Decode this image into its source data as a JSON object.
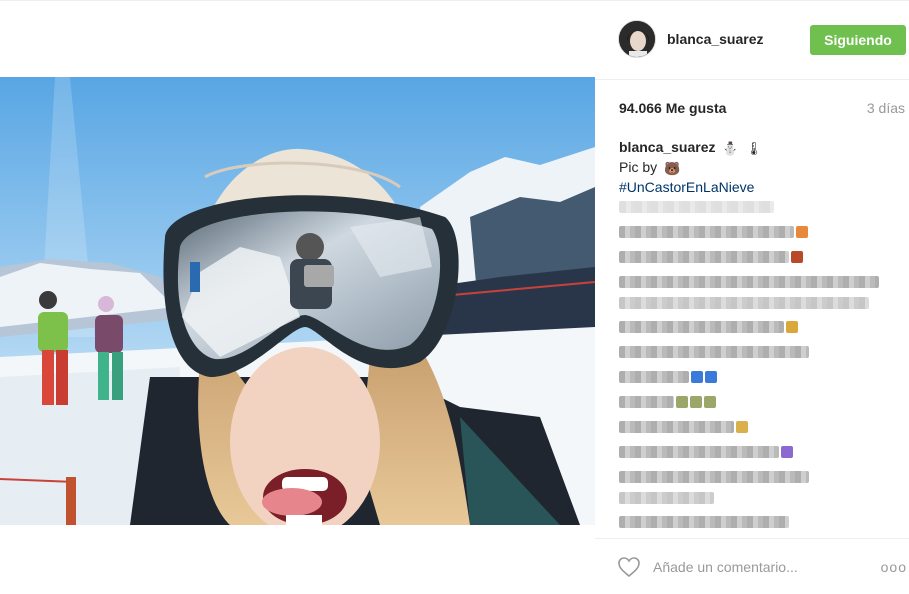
{
  "post": {
    "username": "blanca_suarez",
    "follow_button": "Siguiendo",
    "likes": "94.066 Me gusta",
    "time_ago": "3 días",
    "caption": {
      "user": "blanca_suarez",
      "emojis": [
        "⛄",
        "🌡"
      ],
      "line2_text": "Pic by",
      "line2_emoji": "🐻",
      "hashtag": "#UnCastorEnLaNieve"
    },
    "comment_placeholder": "Añade un comentario...",
    "more_label": "ooo"
  },
  "colors": {
    "follow_bg": "#70c050",
    "hashtag": "#003569",
    "muted": "#999999"
  },
  "icons": {
    "like": "heart-outline-icon",
    "options": "more-options-icon"
  }
}
